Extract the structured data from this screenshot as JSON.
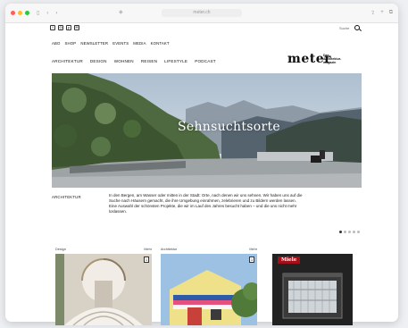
{
  "browser": {
    "url": "meter.ch",
    "colors": {
      "close": "#ff5f57",
      "minimize": "#febc2e",
      "zoom": "#28c840"
    }
  },
  "social": {
    "icons": [
      "facebook-icon",
      "instagram-icon",
      "pinterest-icon",
      "newsletter-icon"
    ]
  },
  "search": {
    "label": "Suche"
  },
  "topnav": {
    "items": [
      "ABO",
      "SHOP",
      "NEWSLETTER",
      "EVENTS",
      "MEDIA",
      "KONTAKT"
    ]
  },
  "catnav": {
    "items": [
      "ARCHITEKTUR",
      "DESIGN",
      "WOHNEN",
      "REISEN",
      "LIFESTYLE",
      "PODCAST"
    ]
  },
  "brand": {
    "logo": "meter",
    "tagline_line1": "Das",
    "tagline_line2": "Architektur-",
    "tagline_line3": "magazin",
    "accent": "#a50f19"
  },
  "hero": {
    "title": "Sehnsuchtsorte"
  },
  "teaser": {
    "category": "ARCHITEKTUR",
    "text": "In den Bergen, am Wasser oder mitten in der Stadt: Orte, nach denen wir uns sehnen. Wir haben uns auf die Suche nach Häusern gemacht, die ihre Umgebung einrahmen, zelebrieren und zu Bildern werden lassen. Eine Auswahl der schönsten Projekte, die wir im Lauf des Jahres besucht haben – und die uns nicht mehr loslassen."
  },
  "pager": {
    "dots": 5,
    "active": 0
  },
  "cards": [
    {
      "category": "Design",
      "meta": "Mehr",
      "count": "1"
    },
    {
      "category": "Architektur",
      "meta": "Mehr",
      "count": "1"
    }
  ],
  "ad": {
    "brand": "Miele"
  }
}
